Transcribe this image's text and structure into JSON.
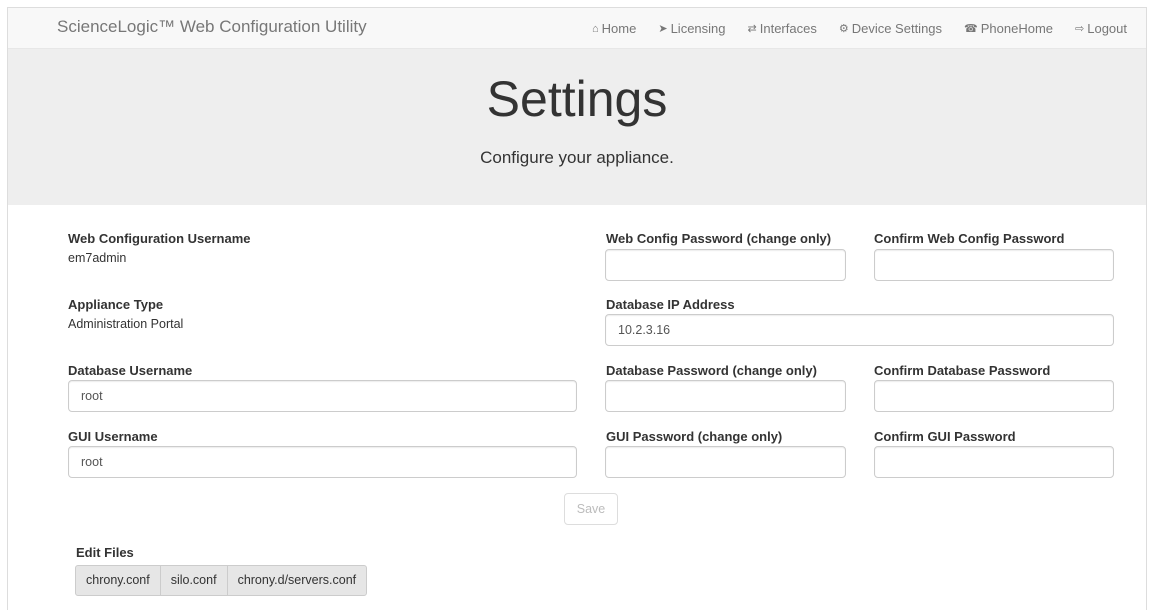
{
  "brand": "ScienceLogic™ Web Configuration Utility",
  "nav": [
    {
      "icon": "home-icon",
      "glyph": "⌂",
      "label": "Home"
    },
    {
      "icon": "licensing-icon",
      "glyph": "➤",
      "label": "Licensing"
    },
    {
      "icon": "interfaces-icon",
      "glyph": "⇄",
      "label": "Interfaces"
    },
    {
      "icon": "gear-icon",
      "glyph": "⚙",
      "label": "Device Settings"
    },
    {
      "icon": "phone-icon",
      "glyph": "☎",
      "label": "PhoneHome"
    },
    {
      "icon": "logout-icon",
      "glyph": "⇨",
      "label": "Logout"
    }
  ],
  "jumbotron": {
    "title": "Settings",
    "subtitle": "Configure your appliance."
  },
  "form": {
    "web_config_username": {
      "label": "Web Configuration Username",
      "value": "em7admin"
    },
    "appliance_type": {
      "label": "Appliance Type",
      "value": "Administration Portal"
    },
    "database_username": {
      "label": "Database Username",
      "value": "root"
    },
    "gui_username": {
      "label": "GUI Username",
      "value": "root"
    },
    "web_config_password": {
      "label": "Web Config Password (change only)",
      "value": ""
    },
    "confirm_web_config_password": {
      "label": "Confirm Web Config Password",
      "value": ""
    },
    "database_ip": {
      "label": "Database IP Address",
      "value": "10.2.3.16"
    },
    "database_password": {
      "label": "Database Password (change only)",
      "value": ""
    },
    "confirm_database_password": {
      "label": "Confirm Database Password",
      "value": ""
    },
    "gui_password": {
      "label": "GUI Password (change only)",
      "value": ""
    },
    "confirm_gui_password": {
      "label": "Confirm GUI Password",
      "value": ""
    },
    "save_label": "Save"
  },
  "edit_files": {
    "title": "Edit Files",
    "files": [
      "chrony.conf",
      "silo.conf",
      "chrony.d/servers.conf"
    ]
  }
}
